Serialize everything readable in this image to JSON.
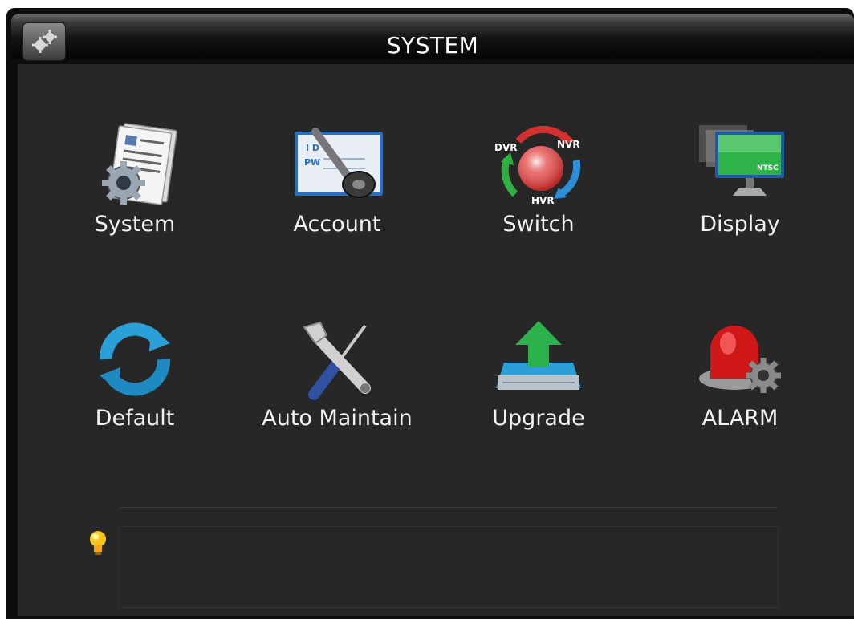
{
  "window": {
    "title": "SYSTEM"
  },
  "menu": {
    "items": [
      {
        "label": "System",
        "icon": "system-settings-icon"
      },
      {
        "label": "Account",
        "icon": "account-key-icon"
      },
      {
        "label": "Switch",
        "icon": "dvr-nvr-hvr-switch-icon",
        "badges": [
          "DVR",
          "NVR",
          "HVR"
        ]
      },
      {
        "label": "Display",
        "icon": "monitor-display-icon",
        "badge": "NTSC"
      },
      {
        "label": "Default",
        "icon": "refresh-default-icon"
      },
      {
        "label": "Auto Maintain",
        "icon": "wrench-screwdriver-icon"
      },
      {
        "label": "Upgrade",
        "icon": "upgrade-arrow-icon"
      },
      {
        "label": "ALARM",
        "icon": "alarm-siren-icon"
      }
    ]
  },
  "tip": {
    "text": "",
    "icon": "lightbulb-icon"
  },
  "colors": {
    "background": "#272727",
    "titlebar": "#111111",
    "text": "#f2f2f2",
    "accent_blue": "#2a9fd8",
    "accent_green": "#2bb24a",
    "alarm_red": "#d01818"
  }
}
